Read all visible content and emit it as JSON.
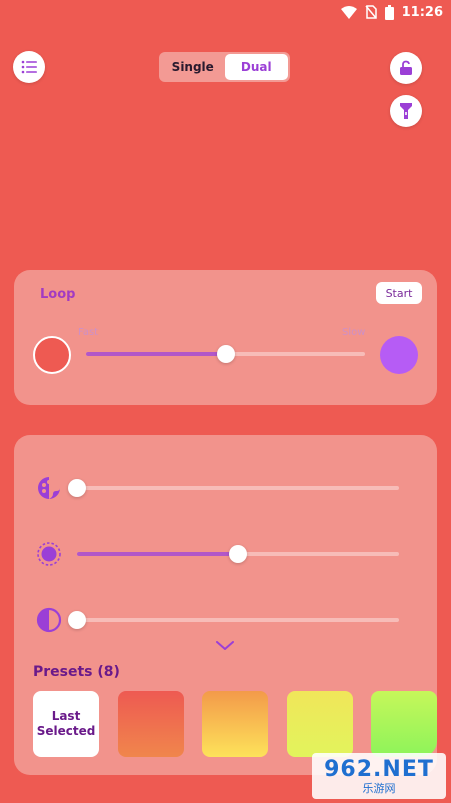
{
  "status_bar": {
    "time": "11:26"
  },
  "mode_toggle": {
    "options": [
      "Single",
      "Dual"
    ],
    "selected": "Dual"
  },
  "loop": {
    "title": "Loop",
    "start_label": "Start",
    "fast_label": "Fast",
    "slow_label": "Slow",
    "speed_value": 0.5,
    "start_color": "#ee5a52",
    "end_color": "#b65cf5"
  },
  "controls": {
    "color_value": 0.0,
    "brightness_value": 0.5,
    "contrast_value": 0.0
  },
  "presets": {
    "title": "Presets (8)",
    "last_label": "Last Selected",
    "swatches": [
      [
        "#ee5a52",
        "#f0864c"
      ],
      [
        "#f39a4a",
        "#fde25a"
      ],
      [
        "#f0e65a",
        "#e2f45c"
      ],
      [
        "#c6f65a",
        "#8df45a"
      ]
    ]
  },
  "colors": {
    "background": "#ee5a52",
    "card": "#f2938c",
    "accent": "#b257c8"
  },
  "watermark": {
    "big": "962.NET",
    "small": "乐游网"
  }
}
